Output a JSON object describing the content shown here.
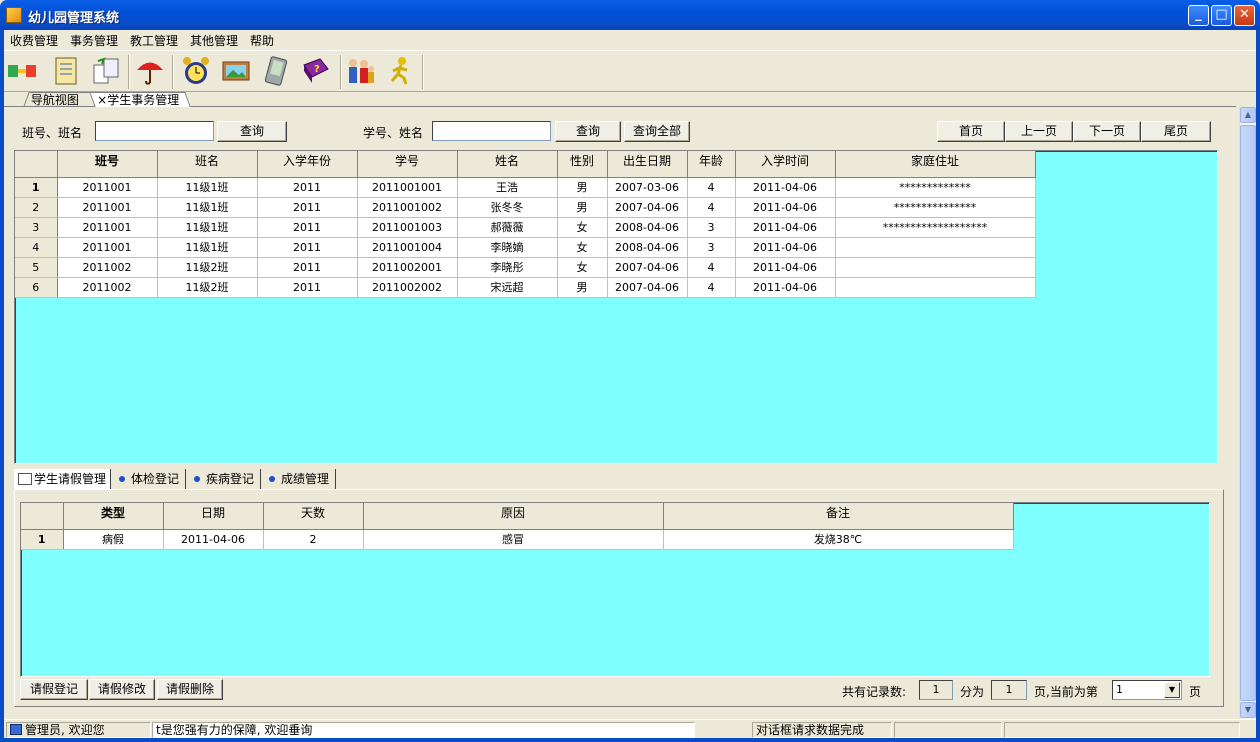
{
  "window": {
    "title": "幼儿园管理系统"
  },
  "menu": [
    "收费管理",
    "事务管理",
    "教工管理",
    "其他管理",
    "帮助"
  ],
  "toolbar_icons": [
    "plug-icon",
    "notebook-icon",
    "swap-icon",
    "umbrella-icon",
    "alarm-clock-icon",
    "picture-icon",
    "tablet-icon",
    "help-book-icon",
    "family-icon",
    "runner-icon"
  ],
  "doc_tabs": {
    "nav": "导航视图",
    "student": "×学生事务管理"
  },
  "search": {
    "class_label": "班号、班名",
    "class_value": "",
    "query1": "查询",
    "student_label": "学号、姓名",
    "student_value": "",
    "query2": "查询",
    "query_all": "查询全部",
    "first": "首页",
    "prev": "上一页",
    "next": "下一页",
    "last": "尾页"
  },
  "students": {
    "headers": [
      "班号",
      "班名",
      "入学年份",
      "学号",
      "姓名",
      "性别",
      "出生日期",
      "年龄",
      "入学时间",
      "家庭住址"
    ],
    "rows": [
      [
        "1",
        "2011001",
        "11级1班",
        "2011",
        "2011001001",
        "王浩",
        "男",
        "2007-03-06",
        "4",
        "2011-04-06",
        "*************"
      ],
      [
        "2",
        "2011001",
        "11级1班",
        "2011",
        "2011001002",
        "张冬冬",
        "男",
        "2007-04-06",
        "4",
        "2011-04-06",
        "***************"
      ],
      [
        "3",
        "2011001",
        "11级1班",
        "2011",
        "2011001003",
        "郝薇薇",
        "女",
        "2008-04-06",
        "3",
        "2011-04-06",
        "*******************"
      ],
      [
        "4",
        "2011001",
        "11级1班",
        "2011",
        "2011001004",
        "李晓嫡",
        "女",
        "2008-04-06",
        "3",
        "2011-04-06",
        ""
      ],
      [
        "5",
        "2011002",
        "11级2班",
        "2011",
        "2011002001",
        "李晓彤",
        "女",
        "2007-04-06",
        "4",
        "2011-04-06",
        ""
      ],
      [
        "6",
        "2011002",
        "11级2班",
        "2011",
        "2011002002",
        "宋远超",
        "男",
        "2007-04-06",
        "4",
        "2011-04-06",
        ""
      ]
    ]
  },
  "subtabs": [
    "学生请假管理",
    "体检登记",
    "疾病登记",
    "成绩管理"
  ],
  "leave": {
    "headers": [
      "类型",
      "日期",
      "天数",
      "原因",
      "备注"
    ],
    "rows": [
      [
        "1",
        "病假",
        "2011-04-06",
        "2",
        "感冒",
        "发烧38℃"
      ]
    ],
    "add": "请假登记",
    "edit": "请假修改",
    "delete": "请假删除",
    "total_label": "共有记录数:",
    "total": "1",
    "split_label": "分为",
    "pages": "1",
    "current_label": "页,当前为第",
    "current": "1",
    "page_suffix": "页"
  },
  "status": {
    "user": "管理员, 欢迎您",
    "marquee": "t是您强有力的保障, 欢迎垂询",
    "message": "对话框请求数据完成"
  }
}
